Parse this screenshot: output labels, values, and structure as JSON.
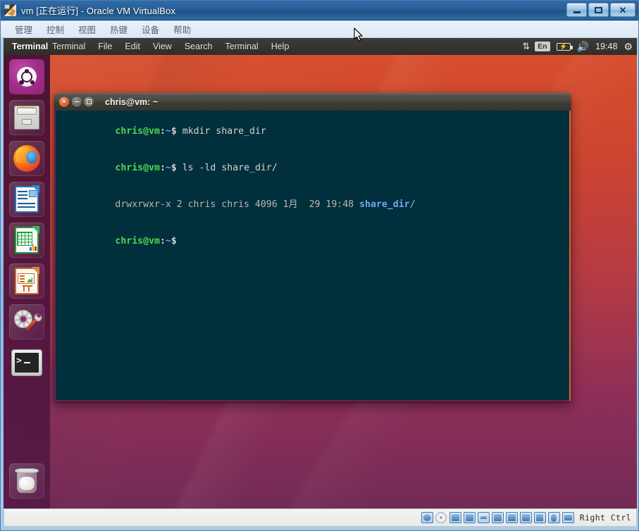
{
  "host_window": {
    "title": "vm [正在运行] - Oracle VM VirtualBox",
    "icon": "virtualbox-icon",
    "controls": {
      "minimize": "–",
      "maximize": "□",
      "close": "✕"
    },
    "menubar": [
      "管理",
      "控制",
      "视图",
      "热键",
      "设备",
      "帮助"
    ]
  },
  "guest": {
    "panel": {
      "app_name": "Terminal",
      "menus": [
        "Terminal",
        "File",
        "Edit",
        "View",
        "Search",
        "Terminal",
        "Help"
      ],
      "indicators": {
        "network": "⇅",
        "keyboard": "En",
        "battery": "battery-icon",
        "volume": "🔊",
        "clock": "19:48",
        "settings": "gear-icon"
      }
    },
    "launcher": [
      {
        "name": "ubuntu-dash",
        "label": "Dash"
      },
      {
        "name": "files",
        "label": "Files"
      },
      {
        "name": "firefox",
        "label": "Firefox"
      },
      {
        "name": "libreoffice-writer",
        "label": "LibreOffice Writer"
      },
      {
        "name": "libreoffice-calc",
        "label": "LibreOffice Calc"
      },
      {
        "name": "libreoffice-impress",
        "label": "LibreOffice Impress"
      },
      {
        "name": "system-settings",
        "label": "System Settings"
      },
      {
        "name": "terminal",
        "label": "Terminal"
      },
      {
        "name": "trash",
        "label": "Trash"
      }
    ],
    "terminal": {
      "title": "chris@vm: ~",
      "buttons": {
        "close": "×",
        "minimize": "–",
        "maximize": "□"
      },
      "lines": [
        {
          "type": "command",
          "prompt_user": "chris@vm",
          "prompt_sep": ":",
          "prompt_path": "~",
          "prompt_dollar": "$",
          "command": " mkdir share_dir"
        },
        {
          "type": "command",
          "prompt_user": "chris@vm",
          "prompt_sep": ":",
          "prompt_path": "~",
          "prompt_dollar": "$",
          "command": " ls -ld share_dir/"
        },
        {
          "type": "output",
          "perms": "drwxrwxr-x 2 chris chris 4096 1月  29 19:48 ",
          "dir": "share_dir/"
        },
        {
          "type": "command",
          "prompt_user": "chris@vm",
          "prompt_sep": ":",
          "prompt_path": "~",
          "prompt_dollar": "$",
          "command": ""
        }
      ]
    }
  },
  "statusbar": {
    "icons": [
      "hard-disk-icon",
      "optical-disk-icon",
      "floppy-icon",
      "network-icon",
      "usb-icon",
      "shared-folders-icon",
      "display-icon",
      "recording-icon",
      "virtualization-icon",
      "mouse-icon",
      "keyboard-icon"
    ],
    "host_key": "Right Ctrl"
  },
  "colors": {
    "terminal_bg": "#022f3c",
    "prompt_green": "#4fd74f",
    "dir_blue": "#6fa8f0",
    "launcher_bg": "#4a123c",
    "wallpaper_top": "#d8502c",
    "wallpaper_bottom": "#722a55",
    "titlebar_blue": "#2a6098"
  }
}
